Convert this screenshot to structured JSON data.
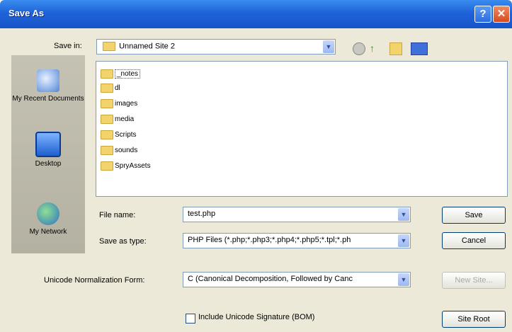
{
  "window": {
    "title": "Save As"
  },
  "save_in": {
    "label": "Save in:",
    "value": "Unnamed Site 2"
  },
  "places": [
    {
      "label": "My Recent Documents",
      "icon": "recent-documents-icon"
    },
    {
      "label": "Desktop",
      "icon": "desktop-icon"
    },
    {
      "label": "My Network",
      "icon": "network-icon"
    }
  ],
  "files": [
    "_notes",
    "dl",
    "images",
    "media",
    "Scripts",
    "sounds",
    "SpryAssets"
  ],
  "file_name": {
    "label": "File name:",
    "value": "test.php"
  },
  "save_as_type": {
    "label": "Save as type:",
    "value": "PHP Files (*.php;*.php3;*.php4;*.php5;*.tpl;*.ph"
  },
  "unicode": {
    "label": "Unicode Normalization Form:",
    "value": "C (Canonical Decomposition, Followed by Canc"
  },
  "include_bom": {
    "label": "Include Unicode Signature (BOM)",
    "checked": false
  },
  "buttons": {
    "save": "Save",
    "cancel": "Cancel",
    "new_site": "New Site...",
    "site_root": "Site Root"
  },
  "colors": {
    "titlebar": "#1f63d8",
    "dialog_bg": "#ece9d8",
    "close": "#d84a20"
  }
}
